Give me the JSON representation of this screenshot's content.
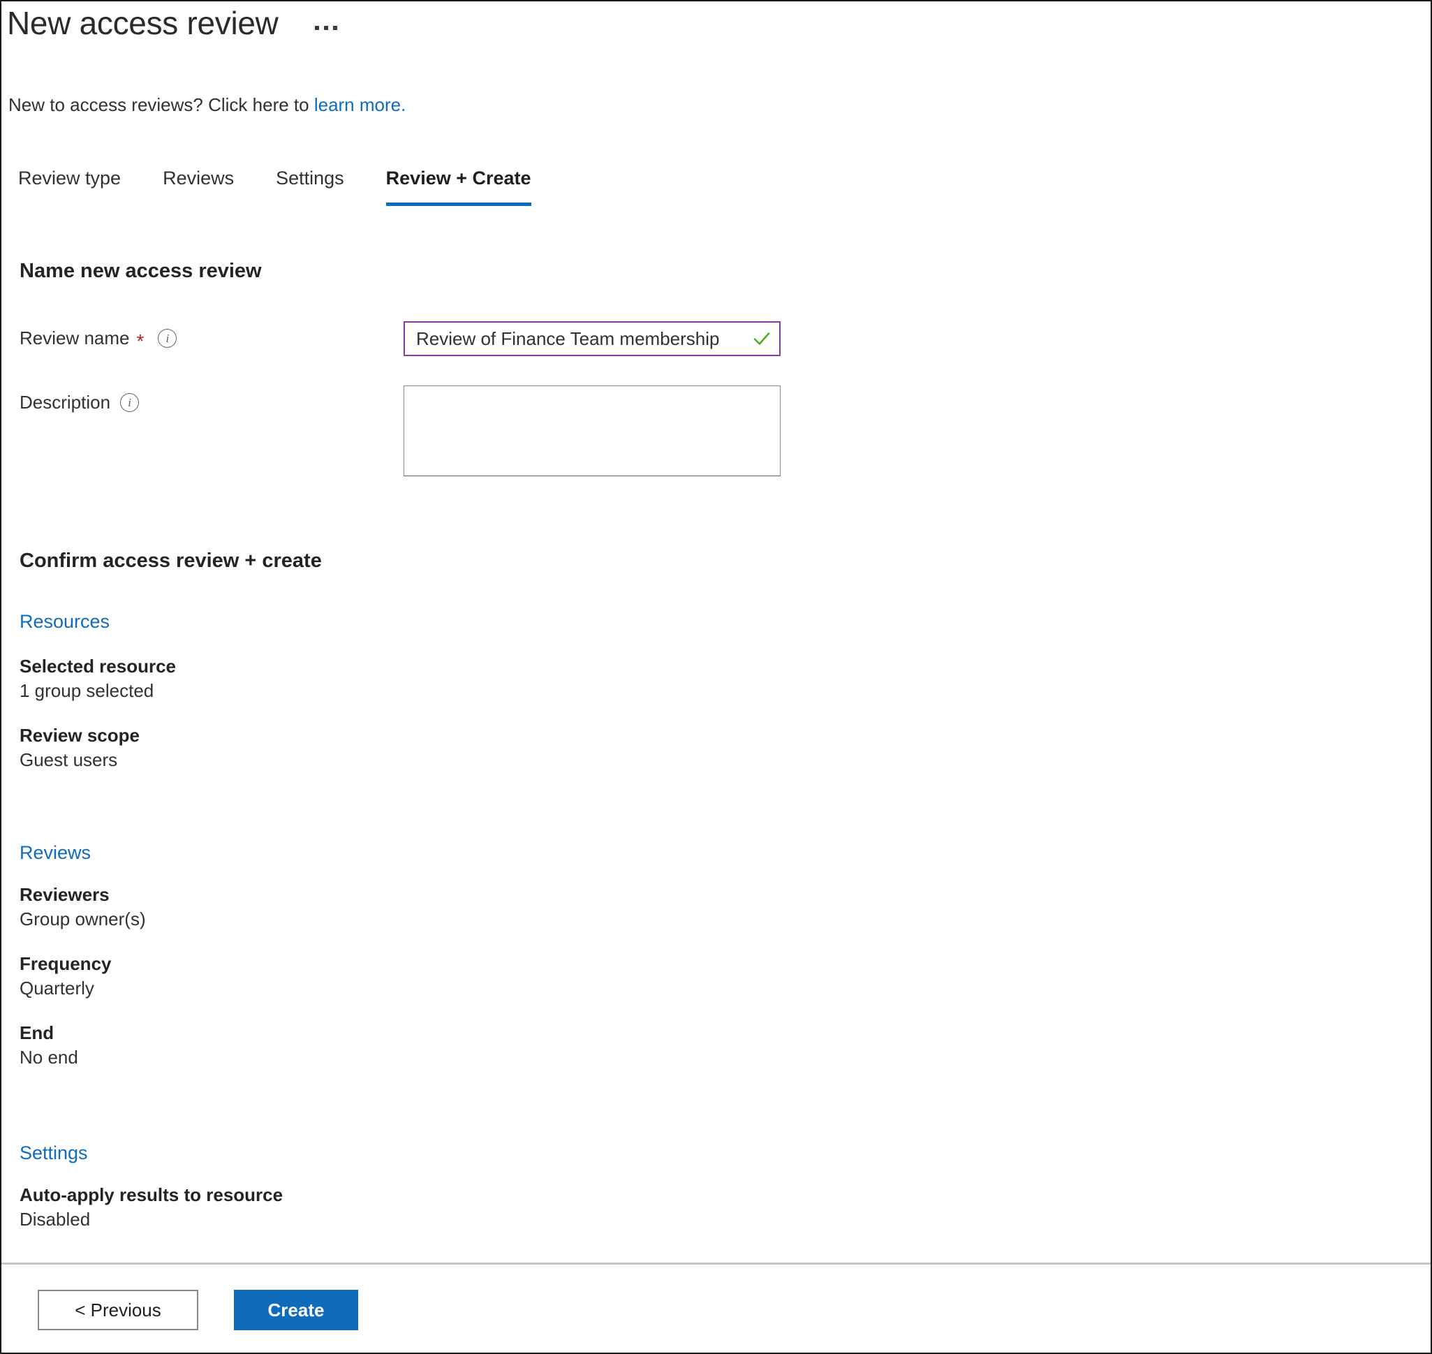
{
  "header": {
    "title": "New access review",
    "more_menu_label": "..."
  },
  "intro": {
    "text": "New to access reviews? Click here to ",
    "link_text": "learn more."
  },
  "tabs": [
    {
      "label": "Review type",
      "active": false
    },
    {
      "label": "Reviews",
      "active": false
    },
    {
      "label": "Settings",
      "active": false
    },
    {
      "label": "Review + Create",
      "active": true
    }
  ],
  "name_section": {
    "heading": "Name new access review",
    "review_name": {
      "label": "Review name",
      "required_marker": "*",
      "value": "Review of Finance Team membership",
      "placeholder": "",
      "valid": true
    },
    "description": {
      "label": "Description",
      "value": "",
      "placeholder": ""
    }
  },
  "confirm_section": {
    "heading": "Confirm access review + create",
    "groups": [
      {
        "link": "Resources",
        "items": [
          {
            "key": "Selected resource",
            "value": "1 group selected"
          },
          {
            "key": "Review scope",
            "value": "Guest users"
          }
        ]
      },
      {
        "link": "Reviews",
        "items": [
          {
            "key": "Reviewers",
            "value": "Group owner(s)"
          },
          {
            "key": "Frequency",
            "value": "Quarterly"
          },
          {
            "key": "End",
            "value": "No end"
          }
        ]
      },
      {
        "link": "Settings",
        "items": [
          {
            "key": "Auto-apply results to resource",
            "value": "Disabled"
          }
        ]
      }
    ]
  },
  "footer": {
    "previous_label": "< Previous",
    "create_label": "Create"
  },
  "colors": {
    "accent_blue": "#0f6cbd",
    "link_blue": "#0f6cbd",
    "focus_purple": "#9b2fae",
    "valid_green": "#4caf22",
    "required_red": "#a4262c",
    "divider_gray": "#c8c6c4"
  }
}
